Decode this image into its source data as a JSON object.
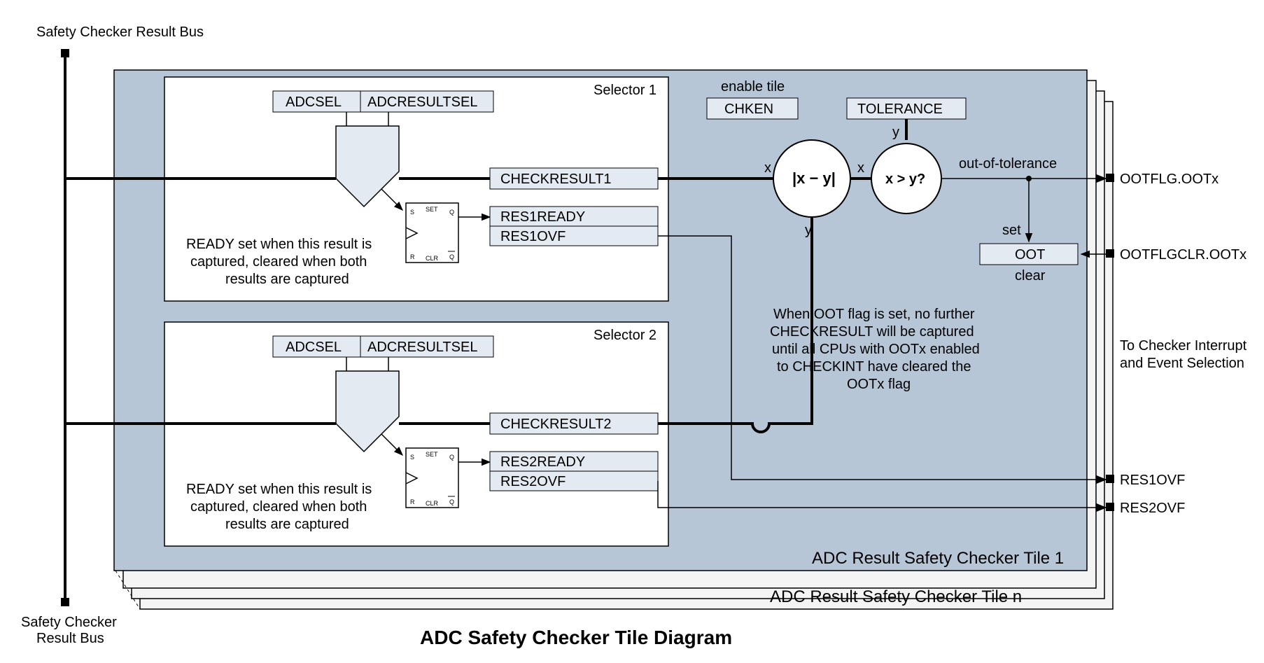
{
  "bus_top_label": "Safety Checker Result Bus",
  "bus_bottom_label_1": "Safety Checker",
  "bus_bottom_label_2": "Result Bus",
  "title": "ADC Safety Checker Tile Diagram",
  "tile1_label": "ADC Result Safety Checker Tile 1",
  "tileN_label": "ADC Result Safety Checker Tile n",
  "selector1": {
    "title": "Selector 1",
    "adcsel": "ADCSEL",
    "adcresultsel": "ADCRESULTSEL",
    "checkresult": "CHECKRESULT1",
    "ready": "RES1READY",
    "ovf": "RES1OVF",
    "note1": "READY set when this result is",
    "note2": "captured, cleared when both",
    "note3": "results are captured"
  },
  "selector2": {
    "title": "Selector 2",
    "adcsel": "ADCSEL",
    "adcresultsel": "ADCRESULTSEL",
    "checkresult": "CHECKRESULT2",
    "ready": "RES2READY",
    "ovf": "RES2OVF",
    "note1": "READY set when this result is",
    "note2": "captured, cleared when both",
    "note3": "results are captured"
  },
  "enable_label": "enable tile",
  "chken": "CHKEN",
  "tolerance": "TOLERANCE",
  "abs_label": "|x − y|",
  "cmp_label": "x > y?",
  "x": "x",
  "y": "y",
  "out_of_tol": "out-of-tolerance",
  "set": "set",
  "clear": "clear",
  "oot_reg": "OOT",
  "ootflg": "OOTFLG.OOTx",
  "ootflgclr": "OOTFLGCLR.OOTx",
  "note_block_1": "When OOT flag is set, no further",
  "note_block_2": "CHECKRESULT will be captured",
  "note_block_3": "until all CPUs with OOTx enabled",
  "note_block_4": "to CHECKINT have cleared the",
  "note_block_5": "OOTx flag",
  "out_right_1": "To Checker Interrupt",
  "out_right_2": "and Event Selection",
  "res1ovf_out": "RES1OVF",
  "res2ovf_out": "RES2OVF",
  "ff_s": "S",
  "ff_set": "SET",
  "ff_q": "Q",
  "ff_r": "R",
  "ff_clr": "CLR",
  "ff_qbar": "Q"
}
